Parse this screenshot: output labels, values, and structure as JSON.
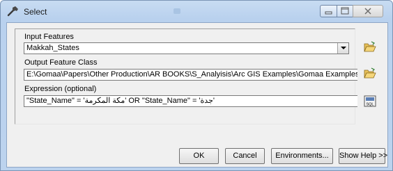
{
  "window": {
    "title": "Select"
  },
  "form": {
    "input_features": {
      "label": "Input Features",
      "value": "Makkah_States"
    },
    "output_feature_class": {
      "label": "Output Feature Class",
      "value": "E:\\Gomaa\\Papers\\Other Production\\AR BOOKS\\S_Analyisis\\Arc GIS Examples\\Gomaa Examples\\Chapt"
    },
    "expression": {
      "label": "Expression (optional)",
      "value": "\"State_Name\" = 'مكة المكرمة' OR \"State_Name\" = 'جدة'"
    }
  },
  "icons": {
    "app": "hammer-icon",
    "input_browse": "open-folder-icon",
    "output_browse": "open-folder-icon",
    "sql": "sql-icon",
    "sql_text": "SQL"
  },
  "buttons": {
    "ok": "OK",
    "cancel": "Cancel",
    "environments": "Environments...",
    "show_help": "Show Help >>"
  },
  "colors": {
    "title_bar": "#bcd3ee",
    "client_bg": "#f0f0f0"
  }
}
